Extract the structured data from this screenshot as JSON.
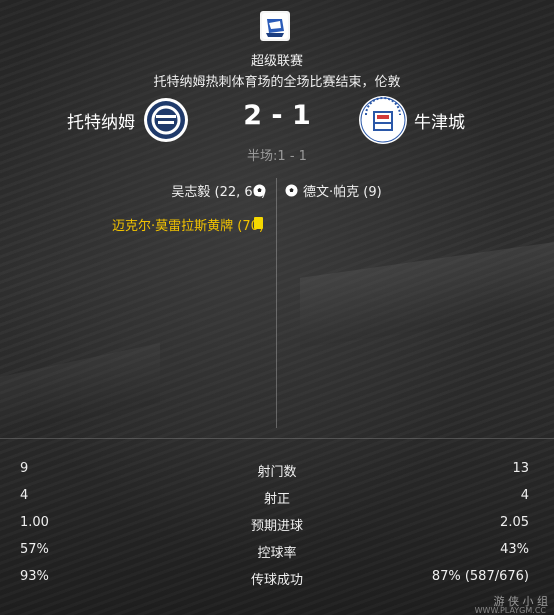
{
  "competition": {
    "name": "超级联赛",
    "logo_icon": "premier-league-logo"
  },
  "match": {
    "description": "托特纳姆热刺体育场的全场比赛结束，伦敦",
    "home_team": "托特纳姆",
    "away_team": "牛津城",
    "score": "2 - 1",
    "halftime": "半场:1 - 1"
  },
  "events": {
    "home_goals": "吴志毅 (22, 66)",
    "away_goals": "德文·帕克 (9)",
    "home_card": "迈克尔·莫雷拉斯黄牌 (70)"
  },
  "stats": [
    {
      "home": "9",
      "label": "射门数",
      "away": "13"
    },
    {
      "home": "4",
      "label": "射正",
      "away": "4"
    },
    {
      "home": "1.00",
      "label": "预期进球",
      "away": "2.05"
    },
    {
      "home": "57%",
      "label": "控球率",
      "away": "43%"
    },
    {
      "home": "93%",
      "label": "传球成功",
      "away": "87% (587/676)"
    }
  ],
  "watermark": {
    "text": "游 侠 小 组",
    "site": "WWW.PLAYGM.CC"
  },
  "colors": {
    "card_text": "#f2c300",
    "yellow_card": "#f5d800",
    "home_crest": "#1f3a6b",
    "away_crest": "#2a57a8"
  }
}
